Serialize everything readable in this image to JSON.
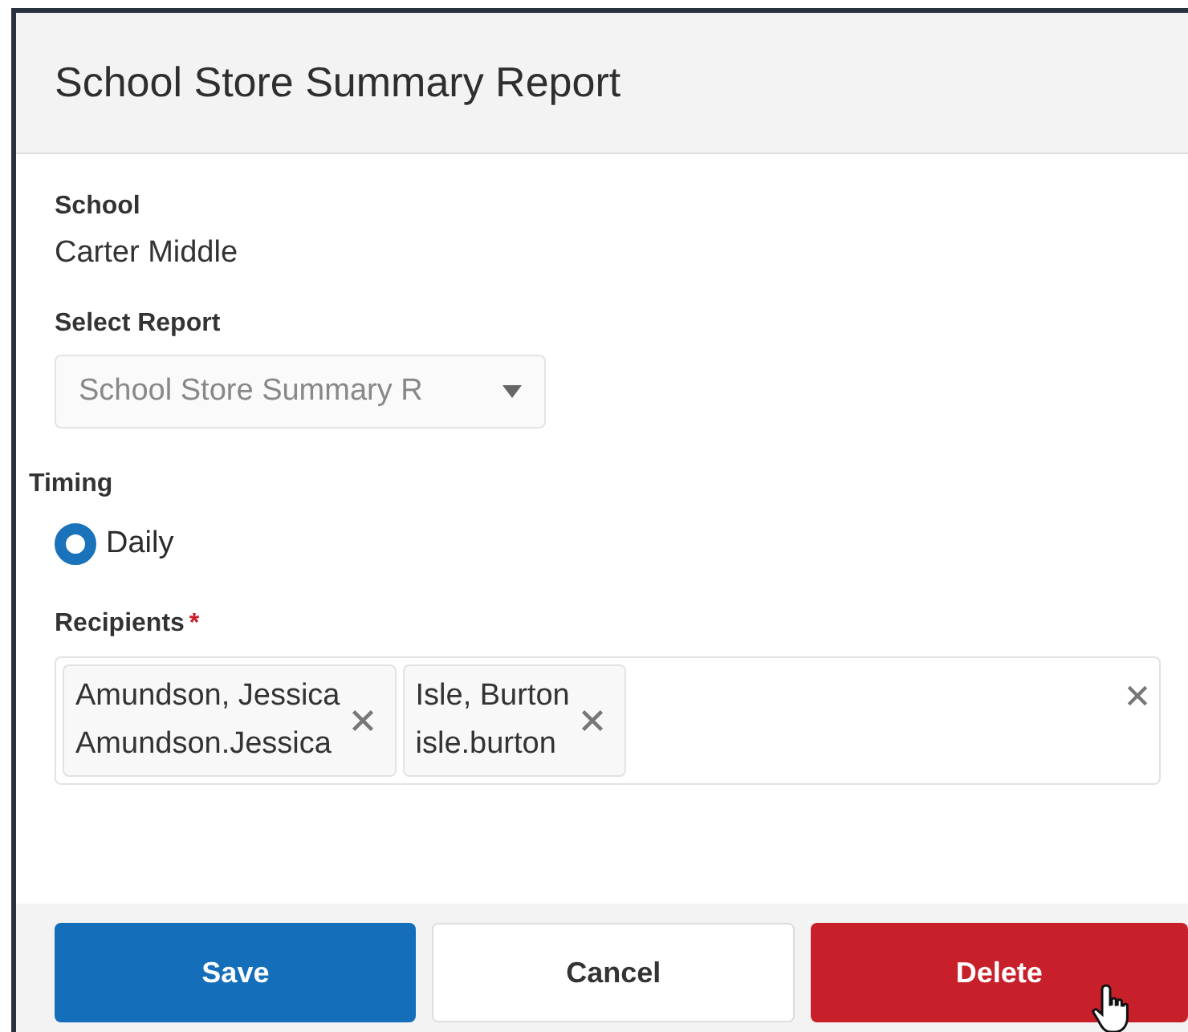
{
  "panel": {
    "title": "School Store Summary Report"
  },
  "school": {
    "label": "School",
    "value": "Carter Middle"
  },
  "select_report": {
    "label": "Select Report",
    "value": "School Store Summary R",
    "disabled": true
  },
  "timing": {
    "label": "Timing",
    "options": [
      {
        "label": "Daily",
        "selected": true
      }
    ]
  },
  "recipients": {
    "label": "Recipients",
    "required_mark": "*",
    "chips": [
      {
        "name": "Amundson, Jessica",
        "username": "Amundson.Jessica"
      },
      {
        "name": "Isle, Burton",
        "username": "isle.burton"
      }
    ]
  },
  "buttons": [
    {
      "label": "Save",
      "kind": "primary"
    },
    {
      "label": "Cancel",
      "kind": "secondary"
    },
    {
      "label": "Delete",
      "kind": "danger"
    }
  ]
}
